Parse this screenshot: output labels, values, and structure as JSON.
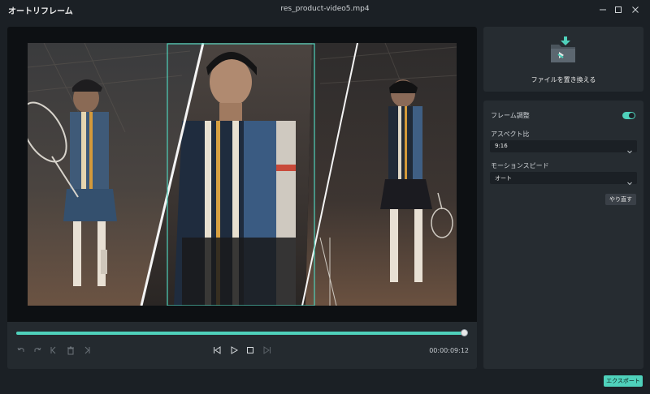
{
  "window": {
    "app_title": "オートリフレーム",
    "file_title": "res_product-video5.mp4"
  },
  "player": {
    "timecode": "00:00:09:12",
    "progress": 0.995
  },
  "replace_file": {
    "label": "ファイルを置き換える"
  },
  "settings": {
    "frame_adjust_label": "フレーム調整",
    "frame_adjust_on": true,
    "aspect_label": "アスペクト比",
    "aspect_value": "9:16",
    "motion_label": "モーションスピード",
    "motion_value": "オート",
    "redo_label": "やり直す"
  },
  "export_label": "エクスポート",
  "colors": {
    "accent": "#4fd1bb",
    "background": "#1b2025",
    "panel": "#262c31"
  }
}
